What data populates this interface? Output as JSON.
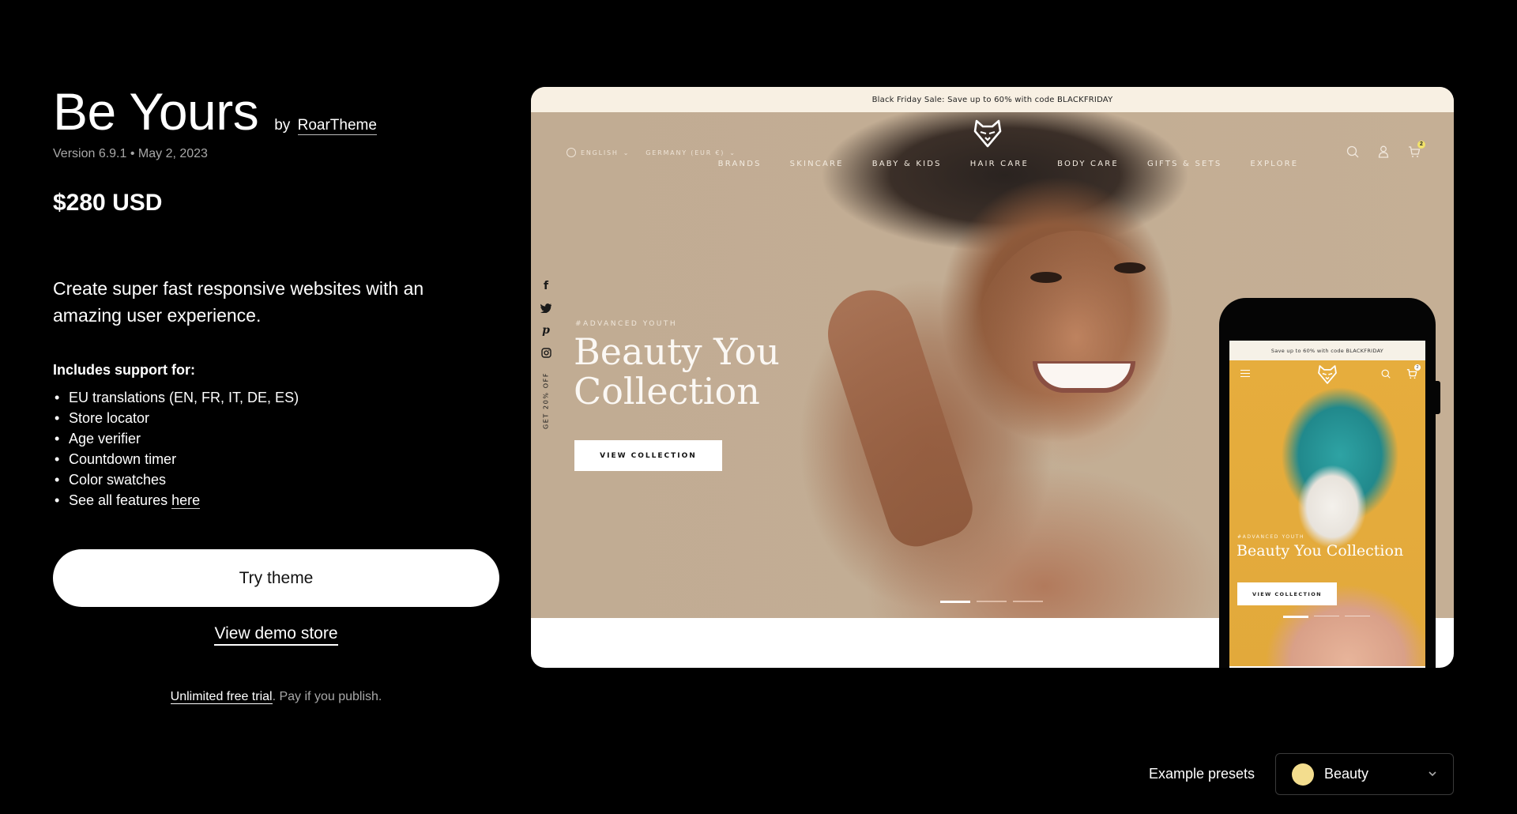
{
  "theme": {
    "title": "Be Yours",
    "by_prefix": "by",
    "author": "RoarTheme",
    "version_line": "Version 6.9.1 • May 2, 2023",
    "price": "$280 USD",
    "description": "Create super fast responsive websites with an amazing user experience.",
    "includes_heading": "Includes support for:",
    "features": [
      "EU translations (EN, FR, IT, DE, ES)",
      "Store locator",
      "Age verifier",
      "Countdown timer",
      "Color swatches"
    ],
    "see_all_prefix": "See all features ",
    "see_all_link": "here",
    "try_button": "Try theme",
    "demo_link": "View demo store",
    "trial_link": "Unlimited free trial",
    "trial_suffix": ". Pay if you publish."
  },
  "preview": {
    "announcement": "Black Friday Sale: Save up to 60% with code BLACKFRIDAY",
    "language": "ENGLISH",
    "country": "GERMANY (EUR €)",
    "nav": [
      "BRANDS",
      "SKINCARE",
      "BABY & KIDS",
      "HAIR CARE",
      "BODY CARE",
      "GIFTS & SETS",
      "EXPLORE"
    ],
    "cart_count": "2",
    "socials": [
      "facebook-icon",
      "twitter-icon",
      "pinterest-icon",
      "instagram-icon"
    ],
    "side_promo": "GET 20% OFF",
    "hero_tag": "#ADVANCED YOUTH",
    "hero_title": "Beauty You Collection",
    "hero_button": "VIEW COLLECTION",
    "slides_total": 3,
    "active_slide": 1
  },
  "mobile": {
    "announcement": "Save up to 60% with code BLACKFRIDAY",
    "cart_count": "2",
    "hero_tag": "#ADVANCED YOUTH",
    "hero_title": "Beauty You Collection",
    "hero_button": "VIEW COLLECTION",
    "slides_total": 3,
    "active_slide": 1
  },
  "presets": {
    "label": "Example presets",
    "selected": "Beauty",
    "swatch_color": "#f3dd8e"
  }
}
